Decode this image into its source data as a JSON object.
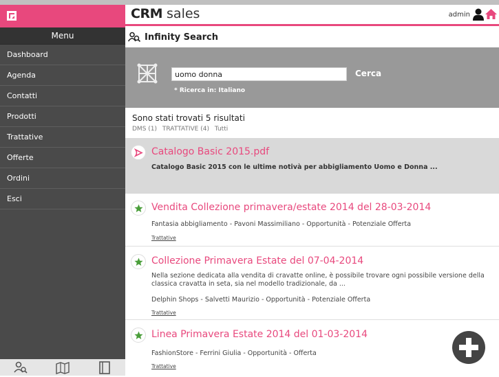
{
  "brand": {
    "bold": "CRM",
    "light": "sales"
  },
  "user": {
    "name": "admin"
  },
  "menu": {
    "title": "Menu",
    "items": [
      "Dashboard",
      "Agenda",
      "Contatti",
      "Prodotti",
      "Trattative",
      "Offerte",
      "Ordini",
      "Esci"
    ]
  },
  "page": {
    "title": "Infinity Search"
  },
  "search": {
    "value": "uomo donna",
    "button": "Cerca",
    "note": "* Ricerca in: Italiano"
  },
  "results": {
    "count_text": "Sono stati trovati 5 risultati",
    "filters": [
      "DMS (1)",
      "TRATTATIVE (4)",
      "Tutti"
    ],
    "items": [
      {
        "title": "Catalogo Basic 2015.pdf",
        "desc": "Catalogo Basic 2015 con le ultime notivà per abbigliamento Uomo e Donna ..."
      },
      {
        "title": "Vendita Collezione primavera/estate 2014 del 28-03-2014",
        "desc": "Fantasia abbigliamento - Pavoni Massimiliano - Opportunità - Potenziale Offerta",
        "link": "Trattative"
      },
      {
        "title": "Collezione Primavera Estate del 07-04-2014",
        "desc": "Nella sezione dedicata alla vendita di cravatte online, è possibile trovare ogni possibile versione della classica cravatta in seta, sia nel modello tradizionale, da ...",
        "meta": "Delphin Shops - Salvetti Maurizio - Opportunità - Potenziale Offerta",
        "link": "Trattative"
      },
      {
        "title": "Linea Primavera Estate 2014 del 01-03-2014",
        "desc": "FashionStore - Ferrini Giulia - Opportunità - Offerta",
        "link": "Trattative"
      }
    ]
  },
  "colors": {
    "accent": "#e8487d",
    "sidebar": "#4a4a4a",
    "panel": "#999999",
    "star": "#4a9e3a"
  },
  "icons": {
    "logo": "logo-icon",
    "user": "user-icon",
    "home": "home-icon",
    "search": "people-search-icon",
    "cube": "cube-icon",
    "pdf": "pdf-icon",
    "star": "star-icon",
    "add": "plus-icon"
  }
}
